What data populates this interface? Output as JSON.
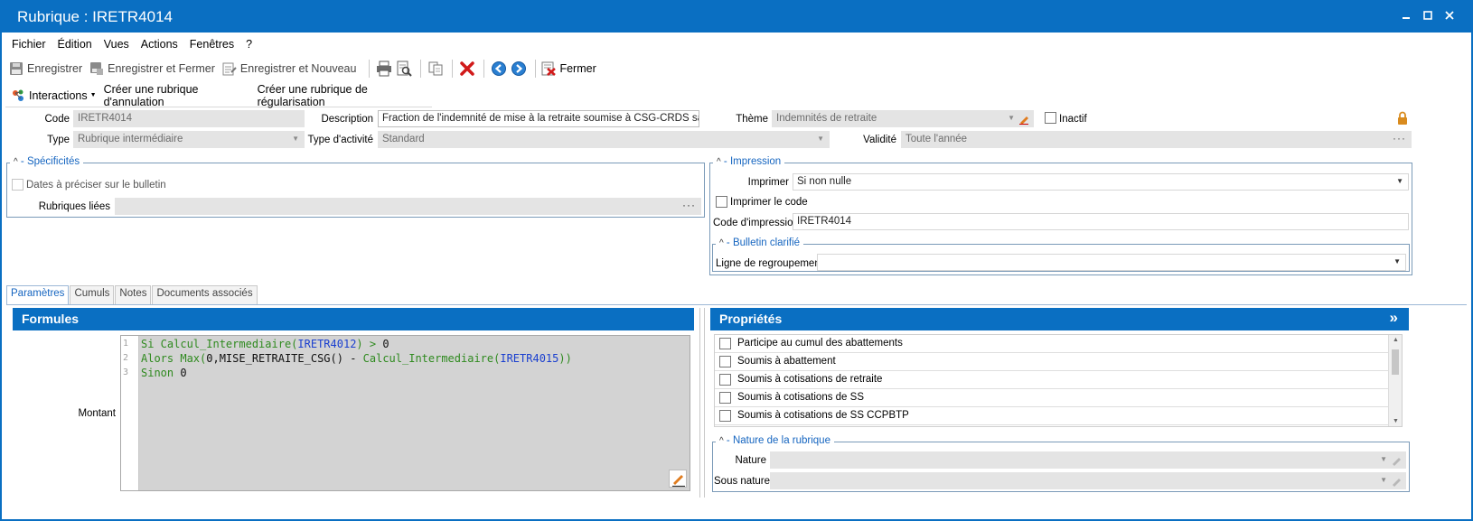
{
  "window": {
    "title": "Rubrique : IRETR4014"
  },
  "menu": [
    "Fichier",
    "Édition",
    "Vues",
    "Actions",
    "Fenêtres",
    "?"
  ],
  "toolbar": {
    "save": "Enregistrer",
    "save_close": "Enregistrer et Fermer",
    "save_new": "Enregistrer et Nouveau",
    "close": "Fermer"
  },
  "actions": {
    "interactions": "Interactions",
    "create_cancel": "Créer une rubrique d'annulation",
    "create_regul": "Créer une rubrique de régularisation"
  },
  "header": {
    "code_label": "Code",
    "code_value": "IRETR4014",
    "description_label": "Description",
    "description_value": "Fraction de l'indemnité de mise à la retraite soumise à CSG-CRDS sans abatt",
    "theme_label": "Thème",
    "theme_value": "Indemnités de retraite",
    "inactive_label": "Inactif",
    "type_label": "Type",
    "type_value": "Rubrique intermédiaire",
    "activity_label": "Type d'activité",
    "activity_value": "Standard",
    "validity_label": "Validité",
    "validity_value": "Toute l'année"
  },
  "specificites": {
    "title": "Spécificités",
    "dates_label": "Dates à préciser sur le bulletin",
    "linked_label": "Rubriques liées",
    "linked_value": ""
  },
  "impression": {
    "title": "Impression",
    "print_label": "Imprimer",
    "print_value": "Si non nulle",
    "print_code_label": "Imprimer le code",
    "print_code_field_label": "Code d'impression",
    "print_code_value": "IRETR4014",
    "bulletin_title": "Bulletin clarifié",
    "grouping_label": "Ligne de regroupement",
    "grouping_value": ""
  },
  "tabs": [
    "Paramètres",
    "Cumuls",
    "Notes",
    "Documents associés"
  ],
  "formules": {
    "title": "Formules",
    "amount_label": "Montant",
    "line_numbers": [
      "1",
      "2",
      "3"
    ],
    "lines": [
      [
        {
          "t": "Si Calcul_Intermediaire(",
          "c": "kw"
        },
        {
          "t": "IRETR4012",
          "c": "ref"
        },
        {
          "t": ") > ",
          "c": "kw"
        },
        {
          "t": "0",
          "c": "tx"
        }
      ],
      [
        {
          "t": "Alors Max(",
          "c": "kw"
        },
        {
          "t": "0,MISE_RETRAITE_CSG() - ",
          "c": "tx"
        },
        {
          "t": "Calcul_Intermediaire(",
          "c": "kw"
        },
        {
          "t": "IRETR4015",
          "c": "ref"
        },
        {
          "t": "))",
          "c": "kw"
        }
      ],
      [
        {
          "t": "Sinon ",
          "c": "kw"
        },
        {
          "t": "0",
          "c": "tx"
        }
      ]
    ]
  },
  "proprietes": {
    "title": "Propriétés",
    "expand_icon": "»",
    "items": [
      "Participe au cumul des abattements",
      "Soumis à abattement",
      "Soumis à cotisations de retraite",
      "Soumis à cotisations de SS",
      "Soumis à cotisations de SS CCPBTP"
    ],
    "nature_title": "Nature de la rubrique",
    "nature_label": "Nature",
    "nature_value": "",
    "subnature_label": "Sous nature",
    "subnature_value": ""
  },
  "colors": {
    "accent": "#0a6fc2",
    "group_title": "#1565c0"
  }
}
